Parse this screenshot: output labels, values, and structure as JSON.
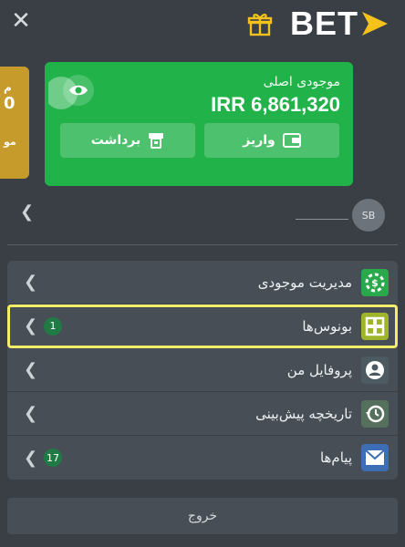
{
  "header": {
    "close_icon": "close-icon",
    "logo_text": "BET",
    "gift_icon": "gift-icon",
    "arrow_color": "#f4c21a"
  },
  "peek_card": {
    "line1": "م",
    "line2": "0",
    "line3": "مو"
  },
  "balance_card": {
    "label": "موجودی اصلی",
    "amount": "IRR 6,861,320",
    "withdraw_label": "برداشت",
    "deposit_label": "واریز",
    "color": "#22b24a"
  },
  "user": {
    "avatar_initials": "SB"
  },
  "menu": {
    "items": [
      {
        "label": "مدیریت موجودی",
        "icon": "wallet-management-icon"
      },
      {
        "label": "بونوس‌ها",
        "icon": "bonus-icon",
        "badge": "1"
      },
      {
        "label": "پروفایل من",
        "icon": "profile-icon"
      },
      {
        "label": "تاریخچه پیش‌بینی",
        "icon": "history-icon"
      },
      {
        "label": "پیام‌ها",
        "icon": "messages-icon",
        "badge": "17"
      }
    ]
  },
  "logout_label": "خروج"
}
